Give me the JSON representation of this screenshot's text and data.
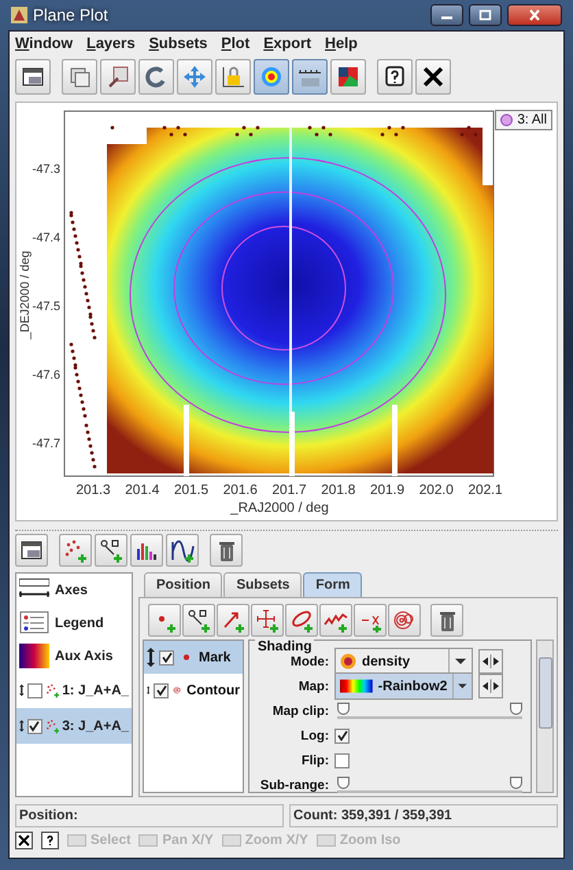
{
  "window": {
    "title": "Plane Plot"
  },
  "menu": [
    "Window",
    "Layers",
    "Subsets",
    "Plot",
    "Export",
    "Help"
  ],
  "toolbar": [
    [
      {
        "kind": "window",
        "selected": false
      }
    ],
    [
      {
        "kind": "stack",
        "selected": false
      },
      {
        "kind": "frame",
        "selected": false
      },
      {
        "kind": "refresh",
        "selected": false
      },
      {
        "kind": "move",
        "selected": false
      },
      {
        "kind": "lock",
        "selected": false
      },
      {
        "kind": "heatmap",
        "selected": true
      },
      {
        "kind": "ruler",
        "selected": true
      },
      {
        "kind": "picture",
        "selected": false
      }
    ],
    [
      {
        "kind": "help",
        "selected": false
      },
      {
        "kind": "close",
        "selected": false
      }
    ]
  ],
  "legend": {
    "label": "3: All"
  },
  "plot": {
    "xlabel": "_RAJ2000 / deg",
    "ylabel": "_DEJ2000 / deg",
    "xticks": [
      "201.3",
      "201.4",
      "201.5",
      "201.6",
      "201.7",
      "201.8",
      "201.9",
      "202.0",
      "202.1"
    ],
    "yticks": [
      "-47.3",
      "-47.4",
      "-47.5",
      "-47.6",
      "-47.7"
    ]
  },
  "layer_toolbar": [
    [
      {
        "kind": "window"
      }
    ],
    [
      {
        "kind": "scatter"
      },
      {
        "kind": "pair"
      },
      {
        "kind": "histogram"
      },
      {
        "kind": "function"
      }
    ],
    [
      {
        "kind": "trash"
      }
    ]
  ],
  "controls": [
    {
      "kind": "axes",
      "label": "Axes",
      "selected": false
    },
    {
      "kind": "legend",
      "label": "Legend",
      "selected": false
    },
    {
      "kind": "aux",
      "label": "Aux Axis",
      "selected": false
    },
    {
      "kind": "layer",
      "label": "1: J_A+A_",
      "checked": false,
      "selected": false
    },
    {
      "kind": "layer",
      "label": "3: J_A+A_",
      "checked": true,
      "selected": true
    }
  ],
  "tabs": [
    {
      "label": "Position",
      "selected": false
    },
    {
      "label": "Subsets",
      "selected": false
    },
    {
      "label": "Form",
      "selected": true
    }
  ],
  "form_toolbar": [
    [
      {
        "kind": "mark"
      },
      {
        "kind": "pair"
      },
      {
        "kind": "vector"
      },
      {
        "kind": "error"
      },
      {
        "kind": "ellipse"
      },
      {
        "kind": "line"
      },
      {
        "kind": "text"
      },
      {
        "kind": "contour"
      }
    ],
    [
      {
        "kind": "trash"
      }
    ]
  ],
  "layers": [
    {
      "kind": "mark",
      "label": "Mark",
      "checked": true,
      "selected": true
    },
    {
      "kind": "contour",
      "label": "Contour",
      "checked": true,
      "selected": false
    }
  ],
  "shading": {
    "title": "Shading",
    "mode": {
      "label": "Mode:",
      "value": "density"
    },
    "map": {
      "label": "Map:",
      "value": "-Rainbow2"
    },
    "map_clip": {
      "label": "Map clip:",
      "thumbs": [
        {
          "level": 0
        },
        {
          "level": 1
        }
      ]
    },
    "log": {
      "label": "Log:",
      "checked": true
    },
    "flip": {
      "label": "Flip:",
      "checked": false
    },
    "sub_range": {
      "label": "Sub-range:",
      "thumbs": [
        {
          "level": 0
        },
        {
          "level": 1
        }
      ]
    }
  },
  "status": {
    "position": "Position:",
    "count": "Count: 359,391 / 359,391"
  },
  "modes": [
    {
      "label": "Select",
      "disabled": true
    },
    {
      "label": "Pan X/Y",
      "disabled": true
    },
    {
      "label": "Zoom X/Y",
      "disabled": true
    },
    {
      "label": "Zoom Iso",
      "disabled": true
    }
  ]
}
